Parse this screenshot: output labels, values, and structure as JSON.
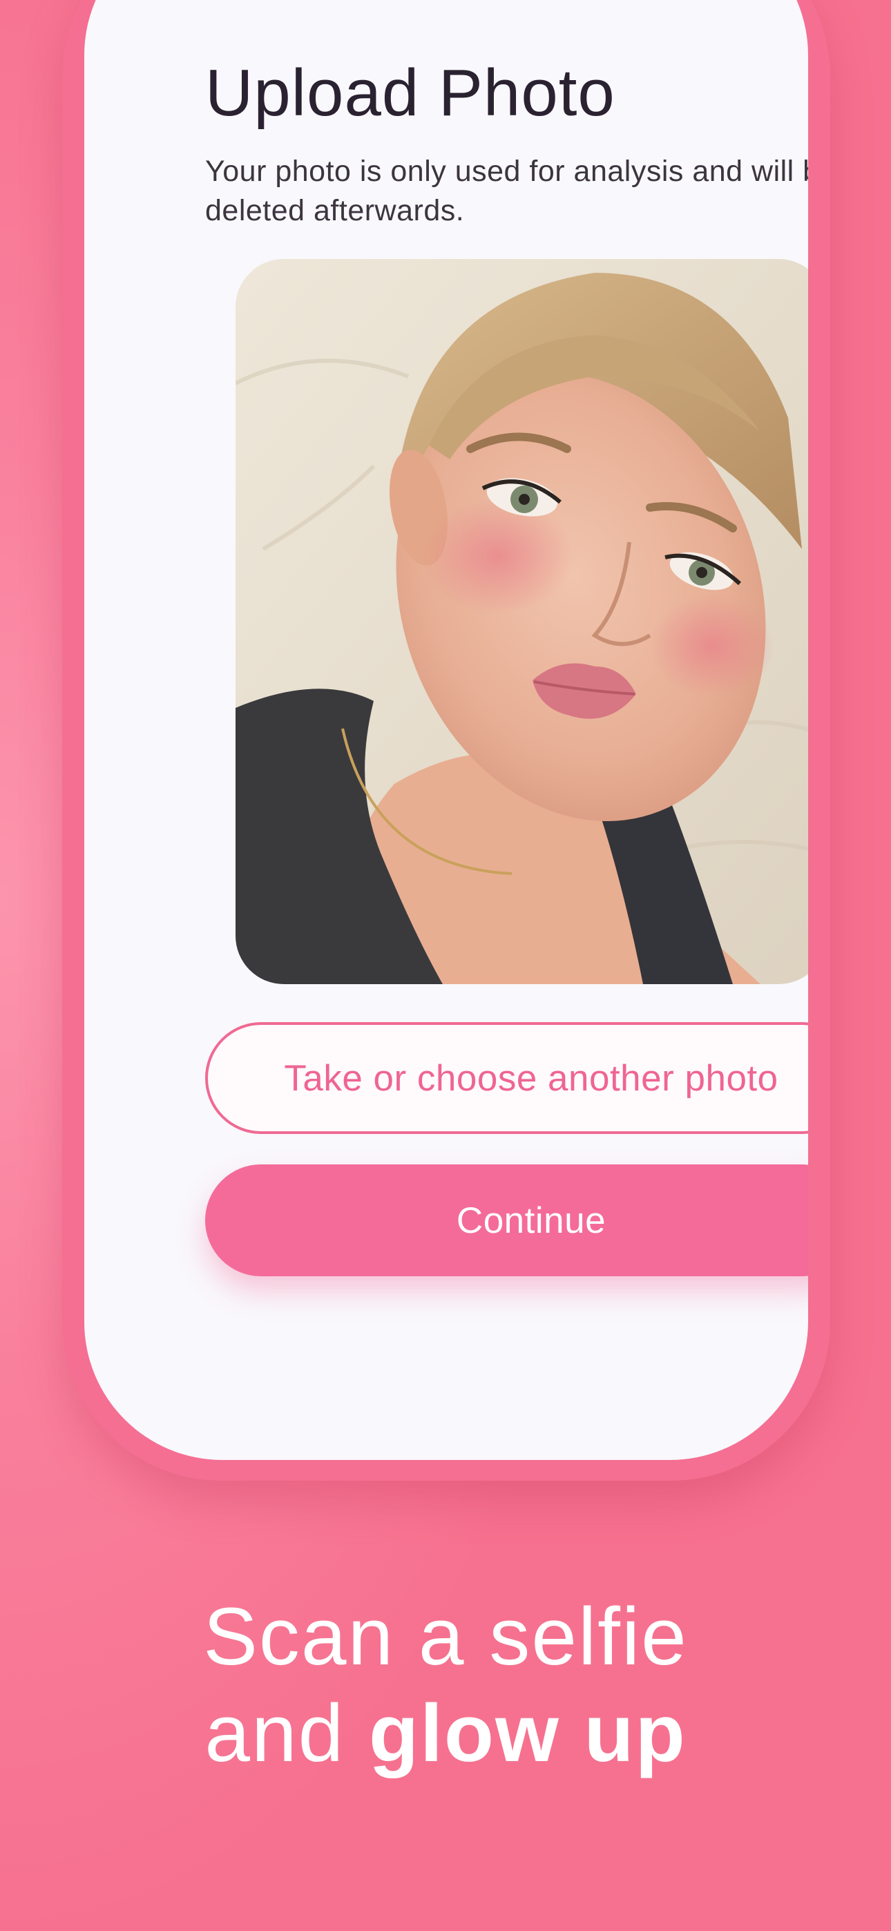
{
  "upload": {
    "title": "Upload Photo",
    "subtitle": "Your photo is only used for analysis and will be deleted afterwards."
  },
  "actions": {
    "secondary_label": "Take or choose another photo",
    "primary_label": "Continue"
  },
  "tagline": {
    "line1": "Scan a selfie",
    "line2_regular": "and ",
    "line2_bold": "glow up"
  },
  "colors": {
    "background": "#f77a98",
    "frame": "#f46f92",
    "screen": "#f9f8fc",
    "accent": "#f46b99",
    "title_text": "#2a2230"
  }
}
